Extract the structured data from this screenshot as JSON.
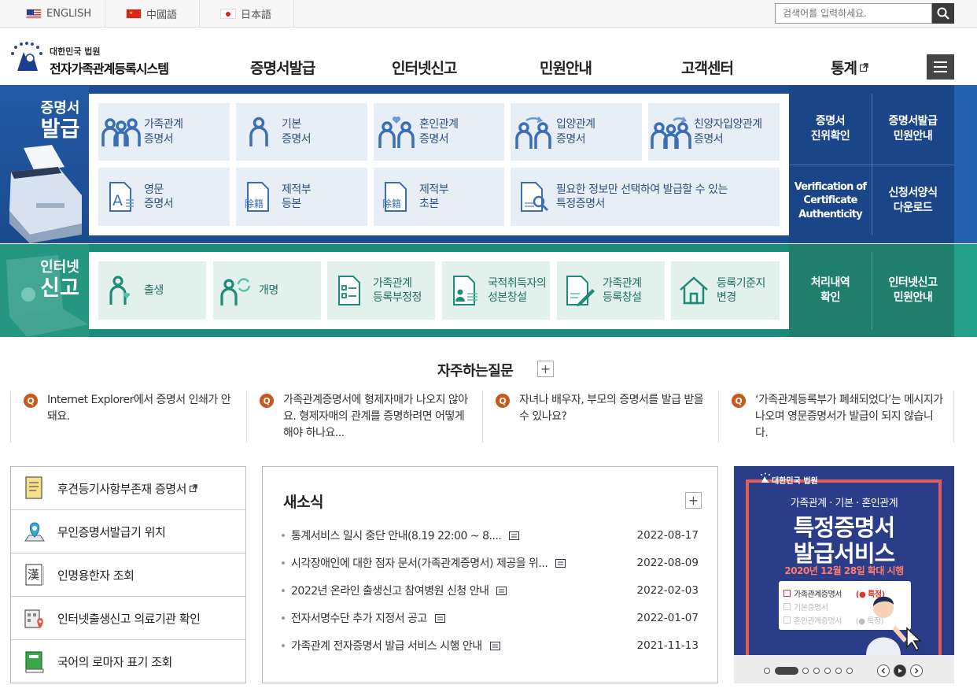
{
  "topbar": {
    "languages": [
      {
        "label": "ENGLISH"
      },
      {
        "label": "中國語"
      },
      {
        "label": "日本語"
      }
    ],
    "search": {
      "placeholder": "검색어를 입력하세요."
    }
  },
  "header": {
    "logo_sub": "대한민국 법원",
    "logo_title": "전자가족관계등록시스템",
    "nav": [
      {
        "label": "증명서발급"
      },
      {
        "label": "인터넷신고"
      },
      {
        "label": "민원안내"
      },
      {
        "label": "고객센터"
      },
      {
        "label": "통계"
      }
    ]
  },
  "cert_section": {
    "title_line1": "증명서",
    "title_line2": "발급",
    "tiles": [
      {
        "line1": "가족관계",
        "line2": "증명서"
      },
      {
        "line1": "기본",
        "line2": "증명서"
      },
      {
        "line1": "혼인관계",
        "line2": "증명서"
      },
      {
        "line1": "입양관계",
        "line2": "증명서"
      },
      {
        "line1": "친양자입양관계",
        "line2": "증명서"
      },
      {
        "line1": "영문",
        "line2": "증명서"
      },
      {
        "line1": "제적부",
        "line2": "등본"
      },
      {
        "line1": "제적부",
        "line2": "초본"
      },
      {
        "line1": "필요한 정보만 선택하여 발급할 수 있는",
        "line2": "특정증명서"
      }
    ],
    "icon_text": {
      "english": "A",
      "removed": "除籍"
    },
    "side_links": [
      {
        "line1": "증명서",
        "line2": "진위확인"
      },
      {
        "line1": "증명서발급",
        "line2": "민원안내"
      },
      {
        "line1": "Verification of",
        "line2": "Certificate",
        "line3": "Authenticity"
      },
      {
        "line1": "신청서양식",
        "line2": "다운로드"
      }
    ]
  },
  "net_section": {
    "title_line1": "인터넷",
    "title_line2": "신고",
    "tiles": [
      {
        "line1": "출생",
        "line2": ""
      },
      {
        "line1": "개명",
        "line2": ""
      },
      {
        "line1": "가족관계",
        "line2": "등록부정정"
      },
      {
        "line1": "국적취득자의",
        "line2": "성본창설"
      },
      {
        "line1": "가족관계",
        "line2": "등록창설"
      },
      {
        "line1": "등록기준지",
        "line2": "변경"
      }
    ],
    "side_links": [
      {
        "line1": "처리내역",
        "line2": "확인"
      },
      {
        "line1": "인터넷신고",
        "line2": "민원안내"
      }
    ]
  },
  "faq": {
    "title": "자주하는질문",
    "more": "+",
    "badge": "Q",
    "items": [
      {
        "text": "Internet Explorer에서 증명서 인쇄가 안돼요."
      },
      {
        "text": "가족관계증명서에 형제자매가 나오지 않아요. 형제자매의 관계를 증명하려면 어떻게 해야 하나요..."
      },
      {
        "text": "자녀나 배우자, 부모의 증명서를 발급 받을 수 있나요?"
      },
      {
        "text": "‘가족관계등록부가 폐쇄되었다’는 메시지가 나오며 영문증명서가 발급이 되지 않습니다."
      }
    ]
  },
  "quick_links": {
    "icon_text": {
      "hanja": "漢"
    },
    "items": [
      {
        "label": "후견등기사항부존재 증명서"
      },
      {
        "label": "무인증명서발급기 위치"
      },
      {
        "label": "인명용한자 조회"
      },
      {
        "label": "인터넷출생신고 의료기관 확인"
      },
      {
        "label": "국어의 로마자 표기 조회"
      }
    ]
  },
  "news": {
    "title": "새소식",
    "more": "+",
    "items": [
      {
        "title": "통계서비스 일시 중단 안내(8.19 22:00 ~ 8....",
        "date": "2022-08-17"
      },
      {
        "title": "시각장애인에 대한 점자 문서(가족관계증명서) 제공을 위...",
        "date": "2022-08-09"
      },
      {
        "title": "2022년 온라인 출생신고 참여병원 신청 안내",
        "date": "2022-02-03"
      },
      {
        "title": "전자서명수단 추가 지정서 공고",
        "date": "2022-01-07"
      },
      {
        "title": "가족관계 전자증명서 발급 서비스 시행 안내",
        "date": "2021-11-13"
      }
    ]
  },
  "banner": {
    "court": "대한민국 법원",
    "subtitle": "가족관계 · 기본 · 혼인관계",
    "big1": "특정증명서",
    "big2": "발급서비스",
    "date_line": "2020년 12월 28일 확대 시행",
    "card_rows": [
      {
        "label": "가족관계증명서",
        "tag": "특정"
      },
      {
        "label": "기본증명서",
        "tag": ""
      },
      {
        "label": "혼인관계증명서",
        "tag": "특정"
      }
    ]
  },
  "colors": {
    "cert_blue": "#1d4e93",
    "net_green": "#1b8c7a",
    "faq_badge": "#c9591a",
    "banner_bg": "#2b3c88"
  }
}
